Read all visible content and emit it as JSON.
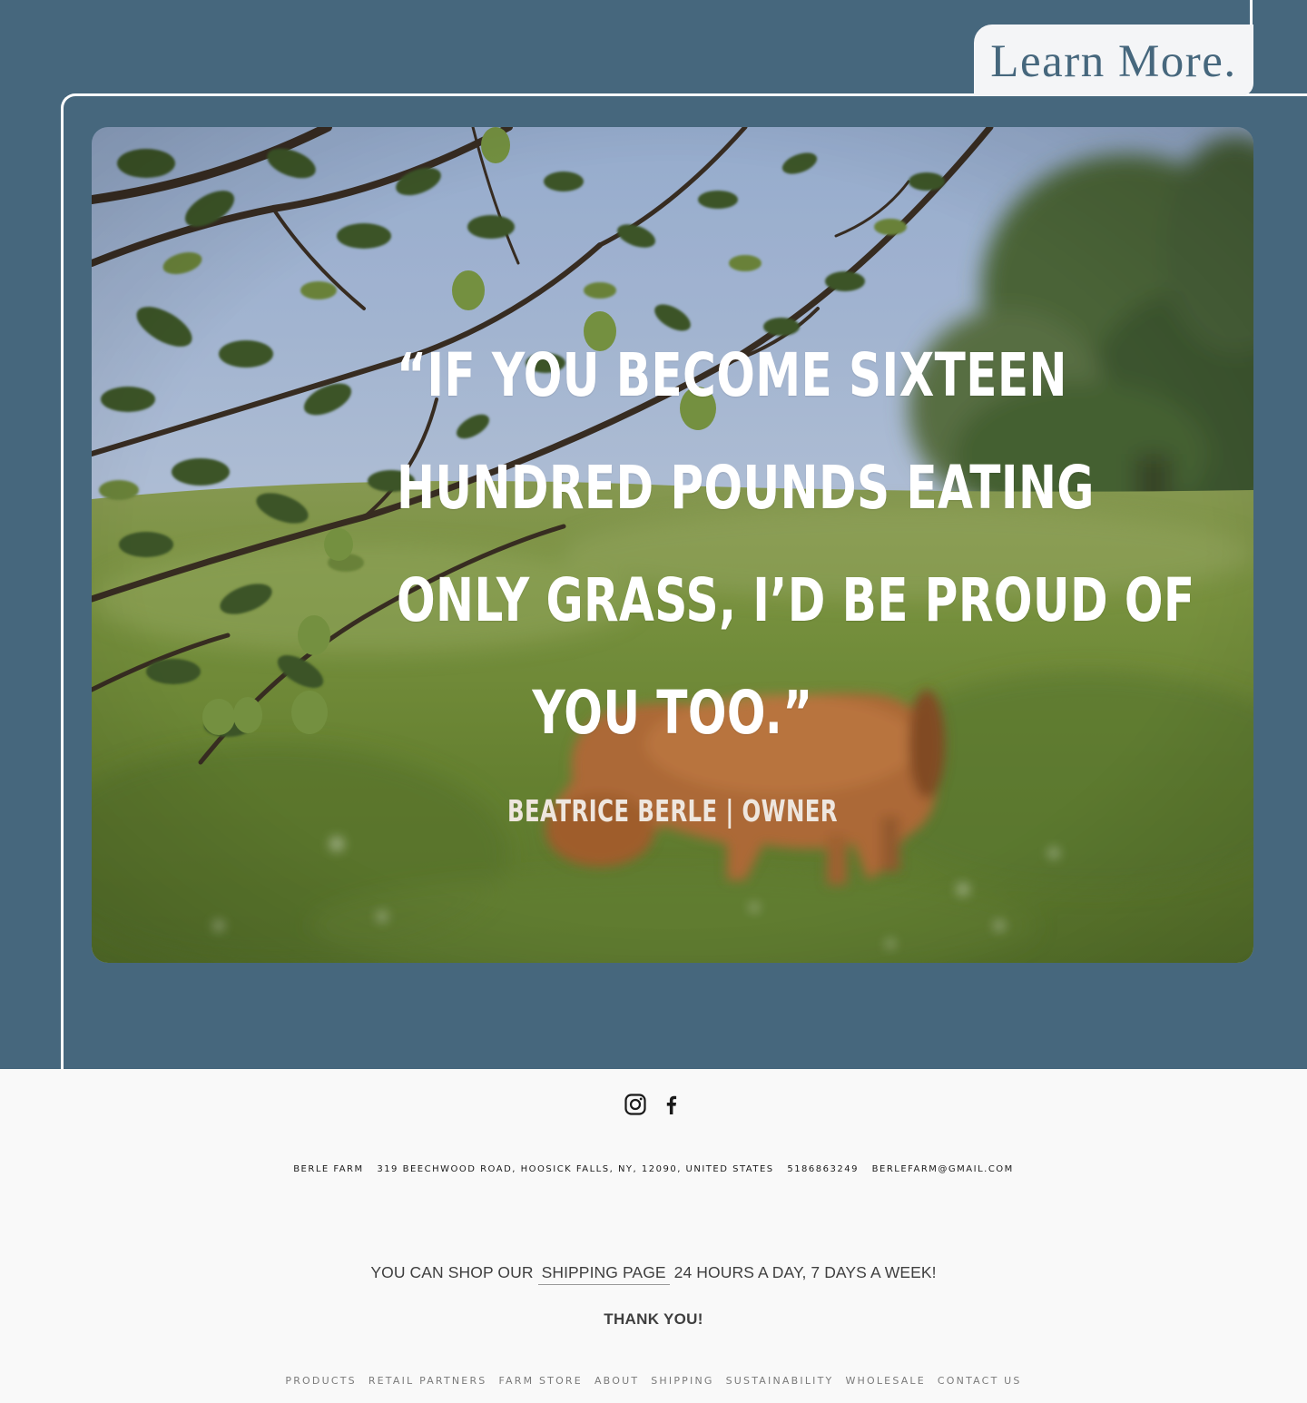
{
  "header": {
    "learn_more_label": "Learn More."
  },
  "quote": {
    "lines": [
      "“If you become sixteen",
      "hundred pounds eating",
      "only grass, I’d be proud of",
      "you too.”"
    ],
    "attribution": "BEATRICE BERLE | OWNER"
  },
  "social": {
    "instagram_icon": "instagram-icon",
    "facebook_icon": "facebook-icon"
  },
  "footer": {
    "business_name": "BERLE FARM",
    "address": "319 BEECHWOOD ROAD, HOOSICK FALLS, NY, 12090, UNITED STATES",
    "phone": "5186863249",
    "email": "BERLEFARM@GMAIL.COM",
    "shop_prefix": "YOU CAN SHOP OUR",
    "shop_link": "SHIPPING PAGE",
    "shop_suffix": "24 HOURS A DAY, 7 DAYS A WEEK!",
    "thank_you": "THANK YOU!",
    "nav": [
      "PRODUCTS",
      "RETAIL PARTNERS",
      "FARM STORE",
      "ABOUT",
      "SHIPPING",
      "SUSTAINABILITY",
      "WHOLESALE",
      "CONTACT US"
    ]
  },
  "colors": {
    "hero_background": "#46677d",
    "footer_background": "#f9f9f9",
    "learn_more_text": "#46677d"
  }
}
